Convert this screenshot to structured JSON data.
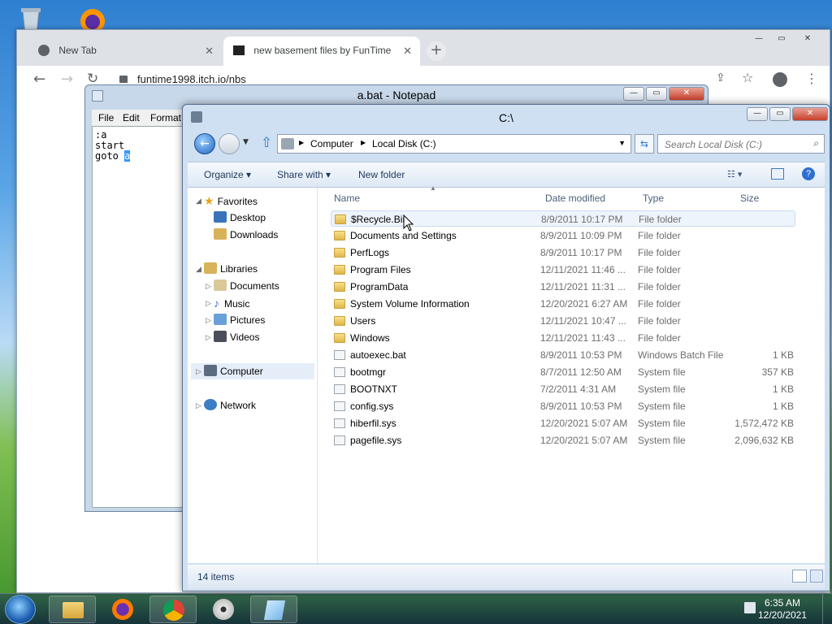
{
  "chrome": {
    "tabs": [
      {
        "title": "New Tab",
        "icon": "chrome-icon"
      },
      {
        "title": "new basement files by FunTime",
        "icon": "itch-icon"
      }
    ],
    "url": "funtime1998.itch.io/nbs"
  },
  "notepad": {
    "title": "a.bat - Notepad",
    "menu": [
      "File",
      "Edit",
      "Format"
    ],
    "lines": [
      ":a",
      "start",
      "goto "
    ],
    "selected_text": "a"
  },
  "explorer": {
    "title": "C:\\",
    "breadcrumb": [
      "Computer",
      "Local Disk (C:)"
    ],
    "search_placeholder": "Search Local Disk (C:)",
    "commands": {
      "organize": "Organize",
      "share": "Share with",
      "new_folder": "New folder"
    },
    "nav": {
      "favorites": "Favorites",
      "favorites_items": [
        "Desktop",
        "Downloads"
      ],
      "libraries": "Libraries",
      "libraries_items": [
        "Documents",
        "Music",
        "Pictures",
        "Videos"
      ],
      "computer": "Computer",
      "network": "Network"
    },
    "columns": {
      "name": "Name",
      "date": "Date modified",
      "type": "Type",
      "size": "Size"
    },
    "files": [
      {
        "name": "$Recycle.Bin",
        "date": "8/9/2011 10:17 PM",
        "type": "File folder",
        "size": "",
        "kind": "folder"
      },
      {
        "name": "Documents and Settings",
        "date": "8/9/2011 10:09 PM",
        "type": "File folder",
        "size": "",
        "kind": "link"
      },
      {
        "name": "PerfLogs",
        "date": "8/9/2011 10:17 PM",
        "type": "File folder",
        "size": "",
        "kind": "folder"
      },
      {
        "name": "Program Files",
        "date": "12/11/2021 11:46 ...",
        "type": "File folder",
        "size": "",
        "kind": "folder"
      },
      {
        "name": "ProgramData",
        "date": "12/11/2021 11:31 ...",
        "type": "File folder",
        "size": "",
        "kind": "folder"
      },
      {
        "name": "System Volume Information",
        "date": "12/20/2021 6:27 AM",
        "type": "File folder",
        "size": "",
        "kind": "folder"
      },
      {
        "name": "Users",
        "date": "12/11/2021 10:47 ...",
        "type": "File folder",
        "size": "",
        "kind": "folder"
      },
      {
        "name": "Windows",
        "date": "12/11/2021 11:43 ...",
        "type": "File folder",
        "size": "",
        "kind": "folder"
      },
      {
        "name": "autoexec.bat",
        "date": "8/9/2011 10:53 PM",
        "type": "Windows Batch File",
        "size": "1 KB",
        "kind": "file"
      },
      {
        "name": "bootmgr",
        "date": "8/7/2011 12:50 AM",
        "type": "System file",
        "size": "357 KB",
        "kind": "file"
      },
      {
        "name": "BOOTNXT",
        "date": "7/2/2011 4:31 AM",
        "type": "System file",
        "size": "1 KB",
        "kind": "file"
      },
      {
        "name": "config.sys",
        "date": "8/9/2011 10:53 PM",
        "type": "System file",
        "size": "1 KB",
        "kind": "file"
      },
      {
        "name": "hiberfil.sys",
        "date": "12/20/2021 5:07 AM",
        "type": "System file",
        "size": "1,572,472 KB",
        "kind": "file"
      },
      {
        "name": "pagefile.sys",
        "date": "12/20/2021 5:07 AM",
        "type": "System file",
        "size": "2,096,632 KB",
        "kind": "file"
      }
    ],
    "status": "14 items"
  },
  "taskbar": {
    "time": "6:35 AM",
    "date": "12/20/2021",
    "pinned": [
      "explorer-icon",
      "firefox-icon",
      "chrome-icon",
      "cd-icon",
      "notepad-icon"
    ]
  }
}
